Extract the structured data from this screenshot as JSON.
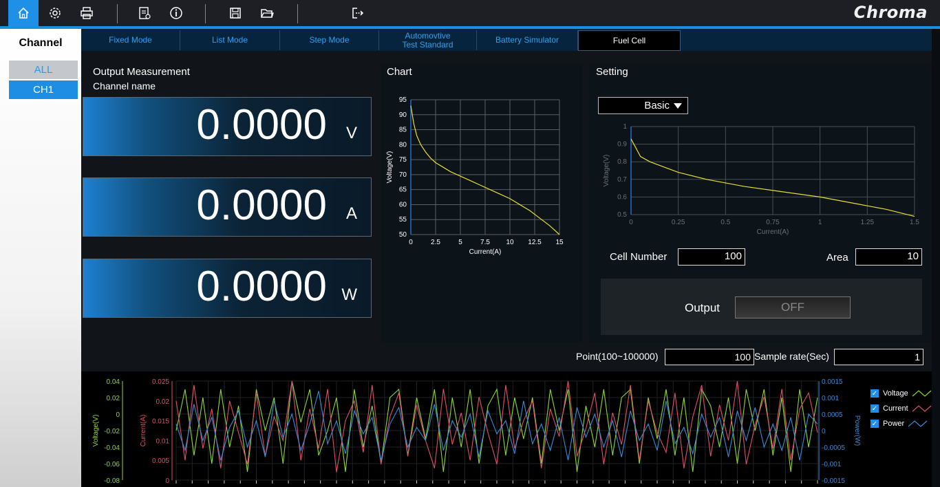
{
  "brand": "Chroma",
  "toolbar": {
    "icons": [
      "home-icon",
      "settings-icon",
      "print-icon",
      "report-icon",
      "info-icon",
      "save-icon",
      "open-folder-icon",
      "exit-icon"
    ]
  },
  "sidebar": {
    "title": "Channel",
    "items": [
      "ALL",
      "CH1"
    ]
  },
  "tabs": [
    {
      "label": "Fixed Mode"
    },
    {
      "label": "List Mode"
    },
    {
      "label": "Step Mode"
    },
    {
      "label": "Automovtive\nTest Standard"
    },
    {
      "label": "Battery Simulator"
    },
    {
      "label": "Fuel Cell"
    }
  ],
  "measurement": {
    "title": "Output Measurement",
    "channel_label": "Channel name",
    "voltage": {
      "value": "0.0000",
      "unit": "V"
    },
    "current": {
      "value": "0.0000",
      "unit": "A"
    },
    "power": {
      "value": "0.0000",
      "unit": "W"
    }
  },
  "chart_panel": {
    "title": "Chart"
  },
  "setting": {
    "title": "Setting",
    "mode": "Basic",
    "cell_number_label": "Cell Number",
    "cell_number": "100",
    "area_label": "Area",
    "area": "10",
    "output_label": "Output",
    "output_state": "OFF"
  },
  "sampling": {
    "point_label": "Point(100~100000)",
    "point": "100",
    "rate_label": "Sample rate(Sec)",
    "rate": "1"
  },
  "colors": {
    "accent": "#1e90e8",
    "voltage": "#8fd838",
    "current": "#e0506a",
    "power": "#3a8cd8",
    "curve": "#e8e030"
  },
  "chart_data": [
    {
      "type": "line",
      "xlabel": "Current(A)",
      "ylabel": "Voltage(V)",
      "xlim": [
        0,
        15
      ],
      "ylim": [
        50,
        95
      ],
      "xticks": [
        "0",
        "2.5",
        "5",
        "7.5",
        "10",
        "12.5",
        "15"
      ],
      "yticks": [
        "50",
        "55",
        "60",
        "65",
        "70",
        "75",
        "80",
        "85",
        "90",
        "95"
      ],
      "grid": true,
      "x": [
        0,
        0.1,
        0.3,
        0.6,
        1,
        1.5,
        2,
        2.5,
        3,
        4,
        5,
        6,
        7,
        8,
        9,
        10,
        11,
        12,
        13,
        14,
        15
      ],
      "y": [
        93,
        91,
        87,
        83,
        80,
        77.5,
        75.5,
        74,
        73,
        71,
        69.5,
        68,
        66.5,
        65,
        63.5,
        62,
        60,
        58,
        55.5,
        53,
        50
      ]
    },
    {
      "type": "line",
      "xlabel": "Current(A)",
      "ylabel": "Voltage(V)",
      "xlim": [
        0,
        1.5
      ],
      "ylim": [
        0.5,
        1
      ],
      "xticks": [
        "0",
        "0.25",
        "0.5",
        "0.75",
        "1",
        "1.25",
        "1.5"
      ],
      "yticks": [
        "0.5",
        "0.6",
        "0.7",
        "0.8",
        "0.9",
        "1"
      ],
      "grid": true,
      "x": [
        0,
        0.02,
        0.05,
        0.1,
        0.15,
        0.25,
        0.4,
        0.6,
        0.8,
        1,
        1.2,
        1.35,
        1.5
      ],
      "y": [
        0.93,
        0.89,
        0.83,
        0.8,
        0.78,
        0.74,
        0.7,
        0.66,
        0.63,
        0.6,
        0.56,
        0.53,
        0.49
      ]
    },
    {
      "type": "line",
      "series": [
        {
          "name": "Voltage",
          "axis": "left",
          "values": [
            -0.02,
            0.03,
            -0.05,
            0.02,
            -0.06,
            0.03,
            -0.04,
            0.01,
            -0.07,
            0.03,
            -0.02,
            0.02,
            -0.06,
            0.04,
            -0.01,
            0.03,
            -0.05,
            -0.02,
            0.02,
            -0.07,
            0.03,
            -0.04,
            0.01,
            -0.06,
            0.02,
            0.03,
            -0.05,
            0.02,
            -0.03,
            0.03,
            -0.07,
            0.02,
            -0.04,
            0.03,
            -0.06,
            0.01,
            0.03,
            -0.05,
            0.02,
            -0.03,
            0.02,
            -0.06,
            0.03,
            -0.02,
            0.03,
            -0.07,
            0.01,
            -0.04,
            0.03,
            -0.05,
            0.02,
            0.03,
            -0.06,
            0.02,
            -0.03,
            0.03,
            -0.05,
            0.02,
            -0.07,
            0.03,
            0.01,
            -0.04,
            0.02,
            -0.06,
            0.03,
            -0.02,
            0.03,
            -0.05,
            0.02,
            -0.07,
            0.03,
            -0.04,
            0.02
          ]
        },
        {
          "name": "Current",
          "axis": "left2",
          "values": [
            0.02,
            0.005,
            0.024,
            0.008,
            0.018,
            0.003,
            0.02,
            0.012,
            0.004,
            0.022,
            0.006,
            0.016,
            0.01,
            0.025,
            0.005,
            0.018,
            0.008,
            0.023,
            0.002,
            0.015,
            0.02,
            0.007,
            0.024,
            0.004,
            0.016,
            0.022,
            0.006,
            0.019,
            0.01,
            0.003,
            0.023,
            0.009,
            0.017,
            0.005,
            0.021,
            0.012,
            0.004,
            0.024,
            0.008,
            0.015,
            0.02,
            0.003,
            0.018,
            0.011,
            0.025,
            0.006,
            0.013,
            0.022,
            0.004,
            0.017,
            0.009,
            0.024,
            0.005,
            0.02,
            0.012,
            0.007,
            0.022,
            0.003,
            0.016,
            0.024,
            0.006,
            0.019,
            0.01,
            0.025,
            0.004,
            0.014,
            0.021,
            0.008,
            0.023,
            0.005,
            0.018,
            0.022,
            0.012
          ]
        },
        {
          "name": "Power",
          "axis": "right",
          "values": [
            0.0002,
            -0.0006,
            0.0008,
            -0.0003,
            0.0004,
            -0.0009,
            0.0001,
            0.0006,
            -0.0005,
            0.0003,
            -0.0008,
            0.0009,
            -0.0002,
            0.0005,
            -0.0006,
            0.0002,
            0.0012,
            -0.0004,
            0.0003,
            -0.0007,
            0.0006,
            -0.0001,
            0.0004,
            -0.0009,
            0.0002,
            0.0007,
            -0.0005,
            0.0001,
            -0.0003,
            0.0008,
            -0.0006,
            0.0003,
            -0.0002,
            0.0005,
            -0.0008,
            0.0006,
            -0.0001,
            0.0003,
            -0.0007,
            0.0009,
            -0.0004,
            0.0002,
            -0.0006,
            0.0004,
            -0.0009,
            0.0007,
            -0.0002,
            0.0005,
            -0.0005,
            0.0003,
            -0.0008,
            0.0006,
            -0.0003,
            0.0002,
            -0.0006,
            0.0009,
            -0.0004,
            0.0001,
            -0.0007,
            0.0005,
            -0.0002,
            0.0004,
            -0.0008,
            0.0006,
            -0.0003,
            0.0007,
            -0.0005,
            0.0002,
            -0.0006,
            0.0004,
            -0.0009,
            0.0005,
            0.0002
          ]
        }
      ],
      "ylabel": "Voltage(V)",
      "ylabel2": "Current(A)",
      "ylabel_right": "Power(W)",
      "ylim": [
        -0.08,
        0.04
      ],
      "yticks": [
        "0.04",
        "0.02",
        "0",
        "-0.02",
        "-0.04",
        "-0.06",
        "-0.08"
      ],
      "ylim2": [
        0,
        0.025
      ],
      "yticks2": [
        "0.025",
        "0.02",
        "0.015",
        "0.01",
        "0.005",
        "0"
      ],
      "ylim_right": [
        -0.0015,
        0.0015
      ],
      "yticks_right": [
        "0.0015",
        "0.001",
        "0.0005",
        "0",
        "-0.0005",
        "-0.001",
        "-0.0015"
      ],
      "legend": [
        "Voltage",
        "Current",
        "Power"
      ],
      "legend_position": "right",
      "grid": true
    }
  ]
}
